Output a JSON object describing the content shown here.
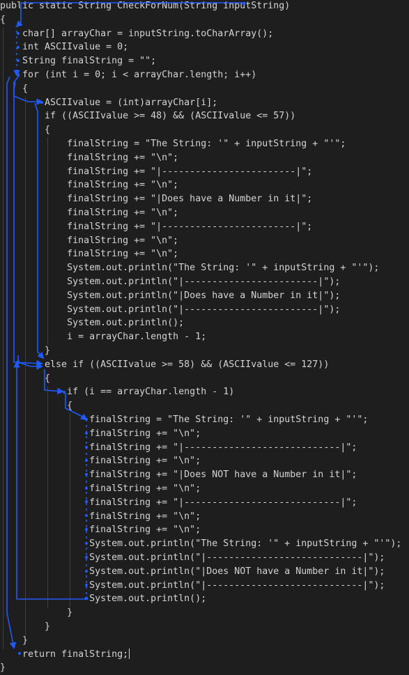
{
  "editor": {
    "lines": [
      "public static String CheckForNum(String inputString)",
      "{",
      "    char[] arrayChar = inputString.toCharArray();",
      "    int ASCIIvalue = 0;",
      "    String finalString = \"\";",
      "    for (int i = 0; i < arrayChar.length; i++)",
      "    {",
      "        ASCIIvalue = (int)arrayChar[i];",
      "        if ((ASCIIvalue >= 48) && (ASCIIvalue <= 57))",
      "        {",
      "            finalString = \"The String: '\" + inputString + \"'\";",
      "            finalString += \"\\n\";",
      "            finalString += \"|------------------------|\";",
      "            finalString += \"\\n\";",
      "            finalString += \"|Does have a Number in it|\";",
      "            finalString += \"\\n\";",
      "            finalString += \"|------------------------|\";",
      "            finalString += \"\\n\";",
      "            finalString += \"\\n\";",
      "            System.out.println(\"The String: '\" + inputString + \"'\");",
      "            System.out.println(\"|------------------------|\");",
      "            System.out.println(\"|Does have a Number in it|\");",
      "            System.out.println(\"|------------------------|\");",
      "            System.out.println();",
      "            i = arrayChar.length - 1;",
      "        }",
      "        else if ((ASCIIvalue >= 58) && (ASCIIvalue <= 127))",
      "        {",
      "            if (i == arrayChar.length - 1)",
      "            {",
      "                finalString = \"The String: '\" + inputString + \"'\";",
      "                finalString += \"\\n\";",
      "                finalString += \"|----------------------------|\";",
      "                finalString += \"\\n\";",
      "                finalString += \"|Does NOT have a Number in it|\";",
      "                finalString += \"\\n\";",
      "                finalString += \"|----------------------------|\";",
      "                finalString += \"\\n\";",
      "                finalString += \"\\n\";",
      "                System.out.println(\"The String: '\" + inputString + \"'\");",
      "                System.out.println(\"|----------------------------|\");",
      "                System.out.println(\"|Does NOT have a Number in it|\");",
      "                System.out.println(\"|----------------------------|\");",
      "                System.out.println();",
      "            }",
      "        }",
      "    }",
      "    return finalString;",
      "}"
    ]
  },
  "colors": {
    "background": "#1e1e1e",
    "text": "#d4d4d4",
    "indent_guide": "#404040",
    "arrow": "#1f5bff"
  }
}
